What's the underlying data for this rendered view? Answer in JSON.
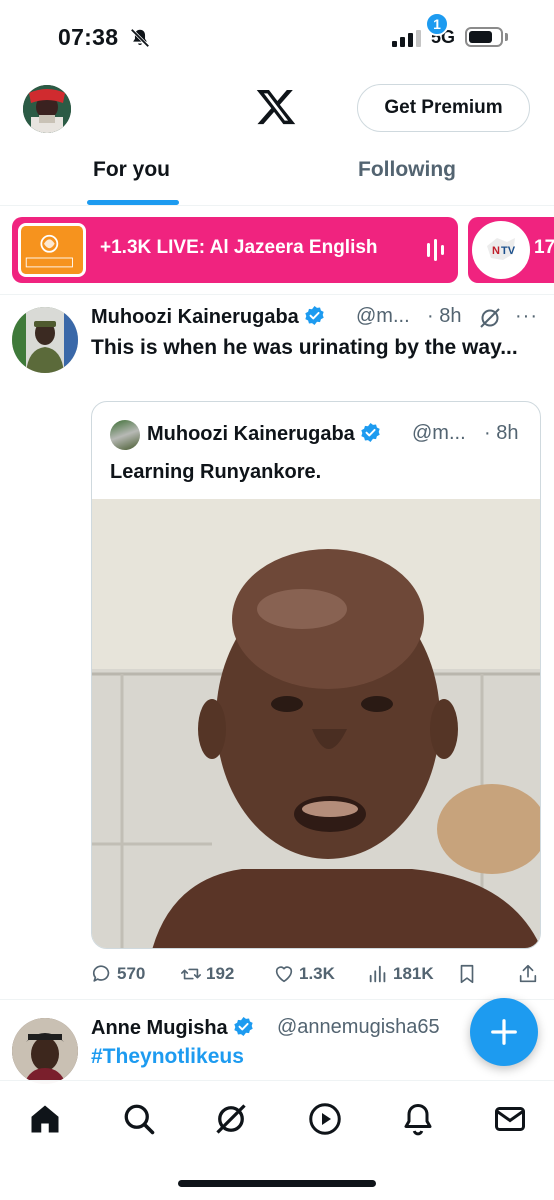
{
  "status_bar": {
    "time": "07:38",
    "network": "5G",
    "battery_level": 0.75
  },
  "header": {
    "premium_label": "Get Premium"
  },
  "tabs": [
    {
      "label": "For you",
      "active": true
    },
    {
      "label": "Following",
      "active": false
    }
  ],
  "spaces": [
    {
      "text": "+1.3K LIVE: Al Jazeera English",
      "thumb_text": "ALJAZEERA",
      "color": "#f0237f"
    },
    {
      "text": "17",
      "thumb_text": "NTV",
      "color": "#f0237f"
    }
  ],
  "tweet": {
    "name": "Muhoozi Kainerugaba",
    "handle": "@m...",
    "time": "· 8h",
    "text": "This is when he was urinating by the way...",
    "quote": {
      "name": "Muhoozi Kainerugaba",
      "handle": "@m...",
      "time": "· 8h",
      "text": "Learning Runyankore."
    },
    "stats": {
      "replies": "570",
      "retweets": "192",
      "likes": "1.3K",
      "views": "181K"
    }
  },
  "tweet2": {
    "name": "Anne Mugisha",
    "handle": "@annemugisha65",
    "text": "#Theynotlikeus"
  },
  "notifications_badge": "1",
  "colors": {
    "accent": "#1d9bf0",
    "live": "#f0237f",
    "text": "#0f1419",
    "muted": "#536471"
  }
}
